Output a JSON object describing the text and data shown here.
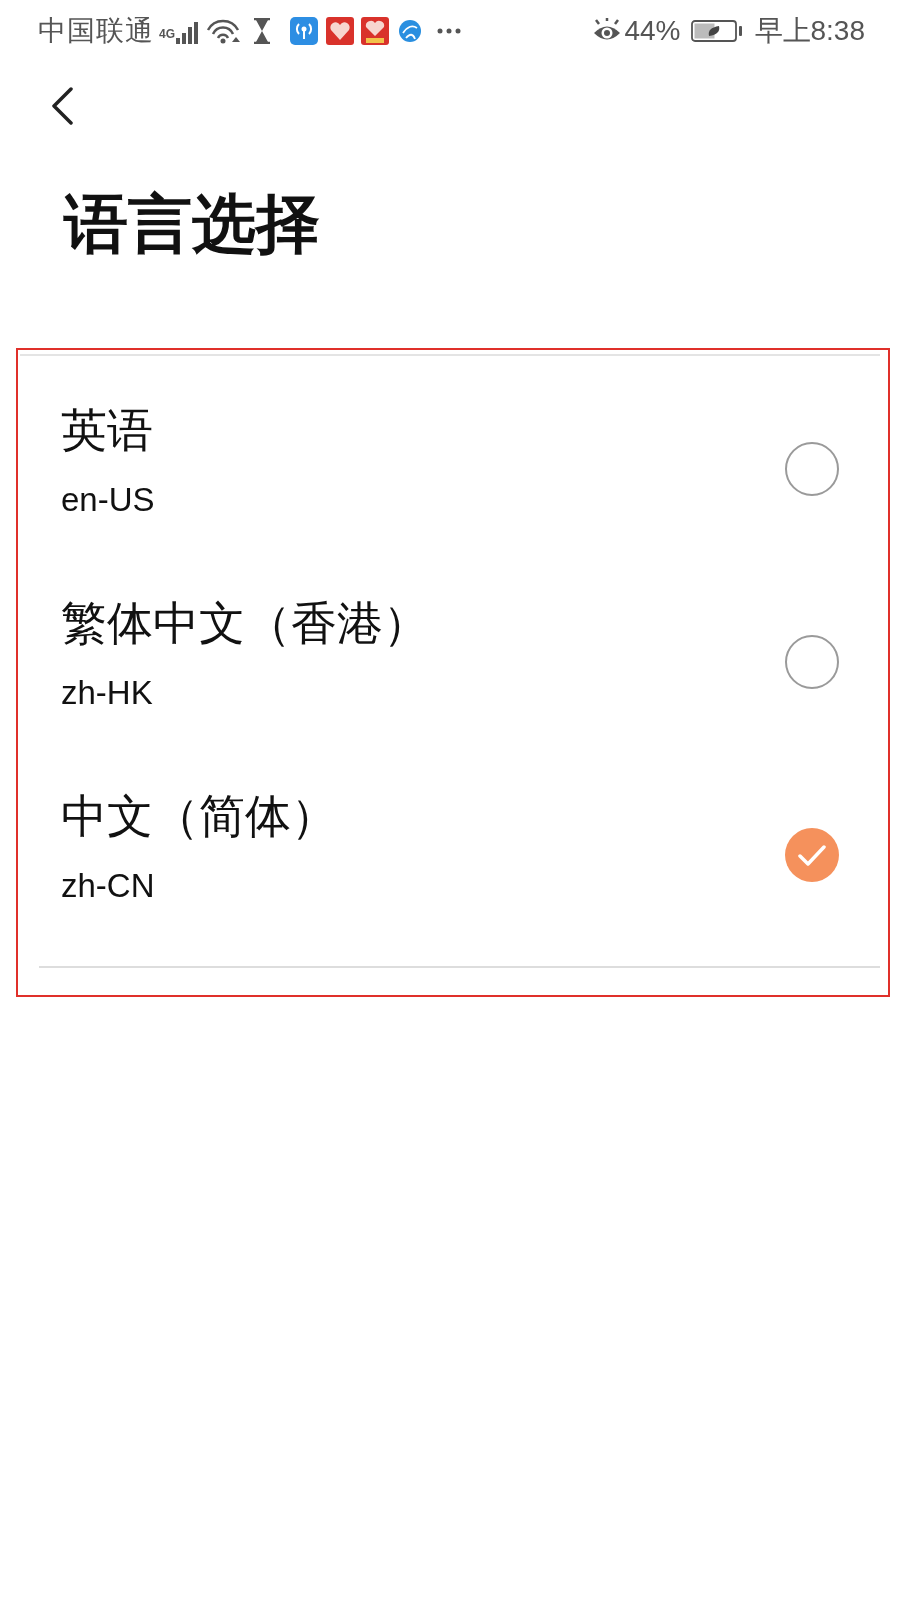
{
  "status_bar": {
    "carrier": "中国联通",
    "network_type": "4G",
    "battery_percent": "44%",
    "time": "早上8:38"
  },
  "title": "语言选择",
  "languages": [
    {
      "name": "英语",
      "code": "en-US",
      "selected": false
    },
    {
      "name": "繁体中文（香港）",
      "code": "zh-HK",
      "selected": false
    },
    {
      "name": "中文（简体）",
      "code": "zh-CN",
      "selected": true
    }
  ]
}
